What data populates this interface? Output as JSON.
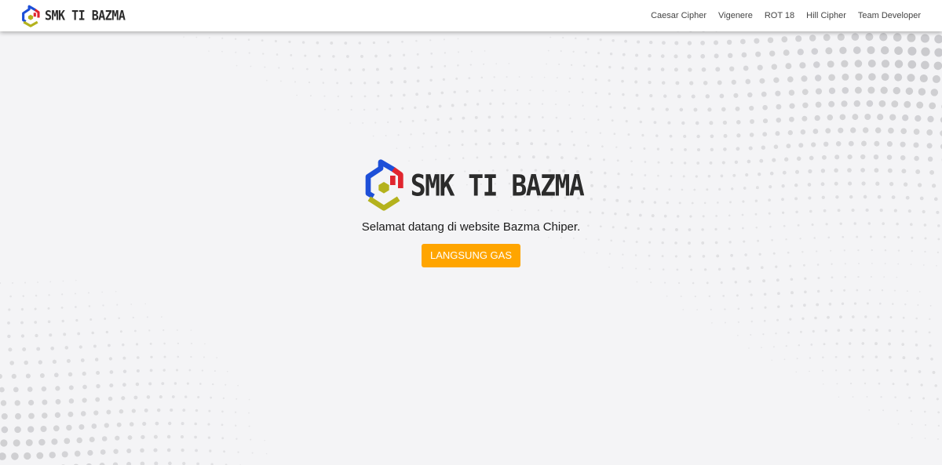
{
  "navbar": {
    "brand": "SMK TI BAZMA",
    "links": [
      "Caesar Cipher",
      "Vigenere",
      "ROT 18",
      "Hill Cipher",
      "Team Developer"
    ]
  },
  "hero": {
    "brand": "SMK TI BAZMA",
    "welcome": "Selamat datang di website Bazma Chiper.",
    "cta": "LANGSUNG GAS"
  },
  "colors": {
    "background": "#f4f4f6",
    "accent_button": "#ffa500",
    "logo_blue": "#1d4fd8",
    "logo_red": "#e0262f",
    "logo_olive": "#b4b21d"
  },
  "icons": [
    "bazma-logo-icon"
  ]
}
